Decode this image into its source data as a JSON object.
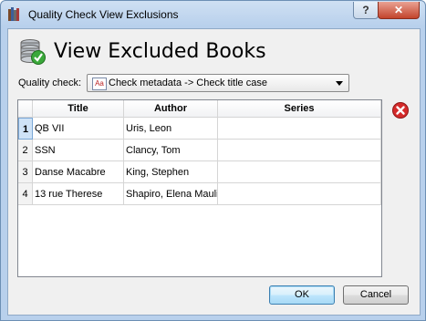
{
  "window": {
    "title": "Quality Check View Exclusions",
    "help_glyph": "?",
    "close_glyph": "✕"
  },
  "heading": "View Excluded Books",
  "quality_check": {
    "label": "Quality check:",
    "icon_text": "Aa",
    "value": "Check metadata -> Check title case"
  },
  "table": {
    "columns": [
      "Title",
      "Author",
      "Series"
    ],
    "rows": [
      {
        "num": "1",
        "title": "QB VII",
        "author": "Uris, Leon",
        "series": ""
      },
      {
        "num": "2",
        "title": "SSN",
        "author": "Clancy, Tom",
        "series": ""
      },
      {
        "num": "3",
        "title": "Danse Macabre",
        "author": "King, Stephen",
        "series": ""
      },
      {
        "num": "4",
        "title": "13 rue Therese",
        "author": "Shapiro, Elena Mauli",
        "series": ""
      }
    ]
  },
  "buttons": {
    "ok": "OK",
    "cancel": "Cancel"
  },
  "colors": {
    "title_bar": "#b8d0ec",
    "remove_icon": "#d42a2a",
    "check_icon": "#3aa83a"
  }
}
